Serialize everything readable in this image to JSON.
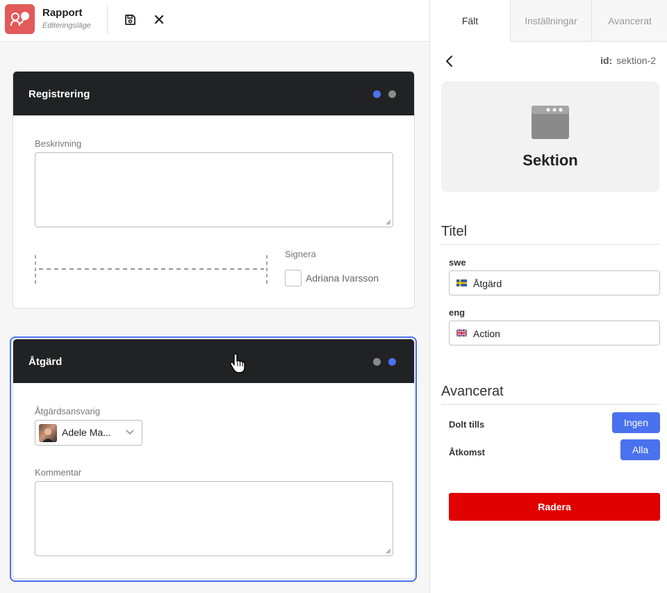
{
  "header": {
    "app_title": "Rapport",
    "app_subtitle": "Editeringsläge"
  },
  "sections": [
    {
      "title": "Registrering",
      "fields": {
        "description_label": "Beskrivning",
        "sign_label": "Signera",
        "signer_name": "Adriana Ivarsson"
      }
    },
    {
      "title": "Åtgärd",
      "fields": {
        "responsible_label": "Åtgärdsansvarig",
        "responsible_value": "Adele Ma...",
        "comment_label": "Kommentar"
      }
    }
  ],
  "panel": {
    "tabs": [
      {
        "label": "Fält",
        "active": true
      },
      {
        "label": "Inställningar",
        "active": false
      },
      {
        "label": "Avancerat",
        "active": false
      }
    ],
    "id_label": "id:",
    "id_value": "sektion-2",
    "element_type": "Sektion",
    "title_group": "Titel",
    "langs": [
      {
        "code": "swe",
        "value": "Åtgärd",
        "flag": "sweden-flag-icon"
      },
      {
        "code": "eng",
        "value": "Action",
        "flag": "uk-flag-icon"
      }
    ],
    "advanced_group": "Avancerat",
    "hidden_until_label": "Dolt tills",
    "hidden_until_value": "Ingen",
    "access_label": "Åtkomst",
    "access_value": "Alla",
    "delete_label": "Radera"
  },
  "colors": {
    "accent": "#4a72ee",
    "danger": "#e10000",
    "card_header": "#212224",
    "app_icon": "#e25a5a"
  }
}
